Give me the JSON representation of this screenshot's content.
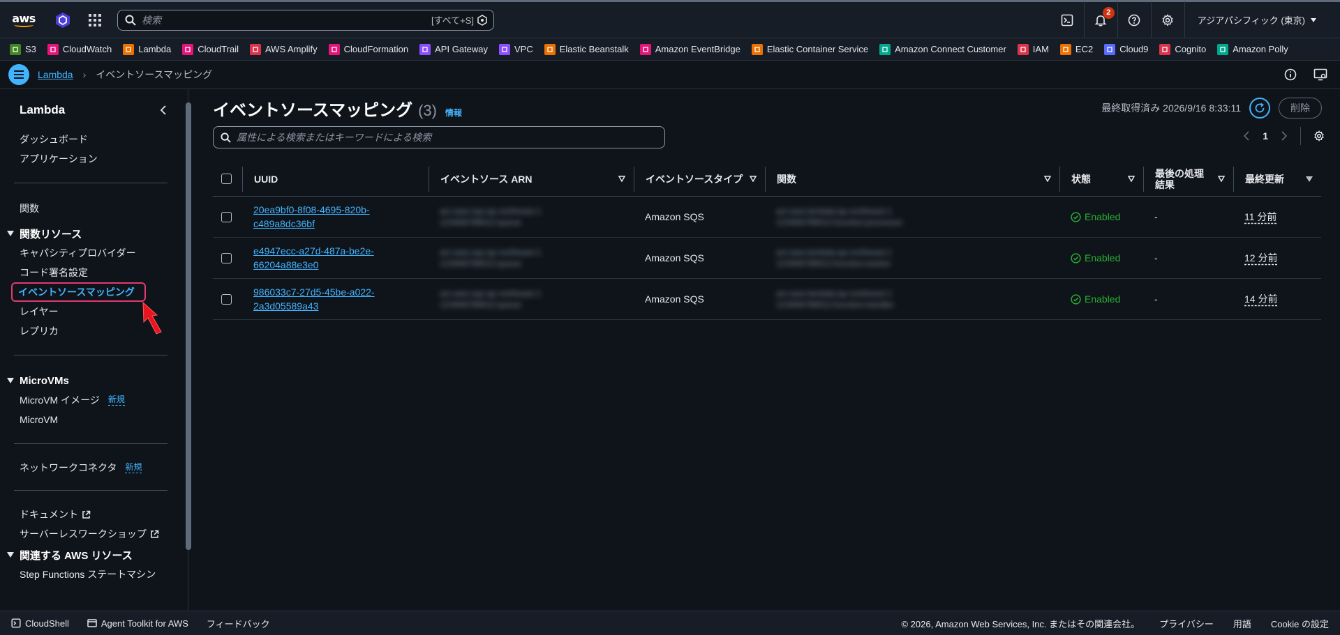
{
  "topnav": {
    "logo_text": "aws",
    "search_placeholder": "検索",
    "search_shortcut": "[すべて+S]",
    "notifications_count": "2",
    "region": "アジアパシフィック (東京)"
  },
  "favorites": [
    {
      "label": "S3",
      "color": "#3f8624"
    },
    {
      "label": "CloudWatch",
      "color": "#e7157b"
    },
    {
      "label": "Lambda",
      "color": "#ed7100"
    },
    {
      "label": "CloudTrail",
      "color": "#e7157b"
    },
    {
      "label": "AWS Amplify",
      "color": "#dd344c"
    },
    {
      "label": "CloudFormation",
      "color": "#e7157b"
    },
    {
      "label": "API Gateway",
      "color": "#8c4fff"
    },
    {
      "label": "VPC",
      "color": "#8c4fff"
    },
    {
      "label": "Elastic Beanstalk",
      "color": "#ed7100"
    },
    {
      "label": "Amazon EventBridge",
      "color": "#e7157b"
    },
    {
      "label": "Elastic Container Service",
      "color": "#ed7100"
    },
    {
      "label": "Amazon Connect Customer",
      "color": "#01a88d"
    },
    {
      "label": "IAM",
      "color": "#dd344c"
    },
    {
      "label": "EC2",
      "color": "#ed7100"
    },
    {
      "label": "Cloud9",
      "color": "#5a6bff"
    },
    {
      "label": "Cognito",
      "color": "#dd344c"
    },
    {
      "label": "Amazon Polly",
      "color": "#01a88d"
    }
  ],
  "breadcrumb": {
    "root": "Lambda",
    "current": "イベントソースマッピング"
  },
  "sidebar": {
    "title": "Lambda",
    "top_items": [
      "ダッシュボード",
      "アプリケーション"
    ],
    "functions": "関数",
    "section_resources": "関数リソース",
    "resource_items": [
      "キャパシティプロバイダー",
      "コード署名設定"
    ],
    "active_item": "イベントソースマッピング",
    "resource_items_after": [
      "レイヤー",
      "レプリカ"
    ],
    "section_microvms": "MicroVMs",
    "microvm_image": "MicroVM イメージ",
    "microvm": "MicroVM",
    "new_tag": "新規",
    "network_connector": "ネットワークコネクタ",
    "docs": "ドキュメント",
    "workshop": "サーバーレスワークショップ",
    "section_related": "関連する AWS リソース",
    "step_functions": "Step Functions ステートマシン"
  },
  "main": {
    "title": "イベントソースマッピング",
    "count": "(3)",
    "info": "情報",
    "last_fetched": "最終取得済み 2026/9/16 8:33:11",
    "delete": "削除",
    "filter_placeholder": "属性による検索またはキーワードによる検索",
    "page": "1"
  },
  "table": {
    "headers": {
      "uuid": "UUID",
      "arn": "イベントソース ARN",
      "type": "イベントソースタイプ",
      "function": "関数",
      "state": "状態",
      "last_result": "最後の処理結果",
      "last_modified": "最終更新"
    },
    "rows": [
      {
        "uuid_1": "20ea9bf0-8f08-4695-820b-",
        "uuid_2": "c489a8dc36bf",
        "arn_1": "arn:aws:sqs:ap-northeast-1",
        "arn_2": "123456789012:queue",
        "type": "Amazon SQS",
        "fn_1": "arn:aws:lambda:ap-northeast-1",
        "fn_2": "123456789012:function:processor",
        "state": "Enabled",
        "result": "-",
        "modified": "11 分前"
      },
      {
        "uuid_1": "e4947ecc-a27d-487a-be2e-",
        "uuid_2": "66204a88e3e0",
        "arn_1": "arn:aws:sqs:ap-northeast-1",
        "arn_2": "123456789012:queue",
        "type": "Amazon SQS",
        "fn_1": "arn:aws:lambda:ap-northeast-1",
        "fn_2": "123456789012:function:worker",
        "state": "Enabled",
        "result": "-",
        "modified": "12 分前"
      },
      {
        "uuid_1": "986033c7-27d5-45be-a022-",
        "uuid_2": "2a3d05589a43",
        "arn_1": "arn:aws:sqs:ap-northeast-1",
        "arn_2": "123456789012:queue",
        "type": "Amazon SQS",
        "fn_1": "arn:aws:lambda:ap-northeast-1",
        "fn_2": "123456789012:function:handler",
        "state": "Enabled",
        "result": "-",
        "modified": "14 分前"
      }
    ]
  },
  "footer": {
    "cloudshell": "CloudShell",
    "agent_toolkit": "Agent Toolkit for AWS",
    "feedback": "フィードバック",
    "copyright": "© 2026, Amazon Web Services, Inc. またはその関連会社。",
    "privacy": "プライバシー",
    "terms": "用語",
    "cookie": "Cookie の設定"
  }
}
